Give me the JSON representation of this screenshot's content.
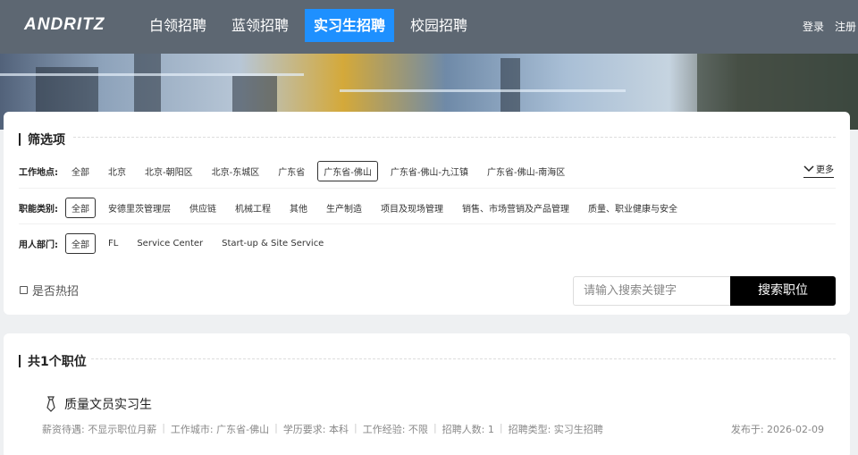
{
  "header": {
    "logo": "ANDRITZ",
    "nav": [
      "白领招聘",
      "蓝领招聘",
      "实习生招聘",
      "校园招聘"
    ],
    "active_nav": "实习生招聘",
    "login": "登录",
    "register": "注册"
  },
  "filters": {
    "title": "筛选项",
    "location": {
      "label": "工作地点:",
      "options": [
        "全部",
        "北京",
        "北京-朝阳区",
        "北京-东城区",
        "广东省",
        "广东省-佛山",
        "广东省-佛山-九江镇",
        "广东省-佛山-南海区"
      ],
      "selected": "广东省-佛山"
    },
    "more": "更多",
    "category": {
      "label": "职能类别:",
      "options": [
        "全部",
        "安德里茨管理层",
        "供应链",
        "机械工程",
        "其他",
        "生产制造",
        "项目及现场管理",
        "销售、市场营销及产品管理",
        "质量、职业健康与安全"
      ],
      "selected": "全部"
    },
    "department": {
      "label": "用人部门:",
      "options": [
        "全部",
        "FL",
        "Service Center",
        "Start-up & Site Service"
      ],
      "selected": "全部"
    },
    "hot_label": "是否热招",
    "search": {
      "placeholder": "请输入搜索关键字",
      "button": "搜索职位"
    }
  },
  "results": {
    "title": "共1个职位",
    "jobs": [
      {
        "title": "质量文员实习生",
        "meta": [
          "薪资待遇: 不显示职位月薪",
          "工作城市: 广东省-佛山",
          "学历要求: 本科",
          "工作经验: 不限",
          "招聘人数: 1",
          "招聘类型: 实习生招聘"
        ],
        "date": "发布于: 2026-02-09"
      }
    ]
  },
  "colors": {
    "header_bg": "#5d6772",
    "active_nav": "#1e90ff",
    "search_button": "#000000"
  }
}
